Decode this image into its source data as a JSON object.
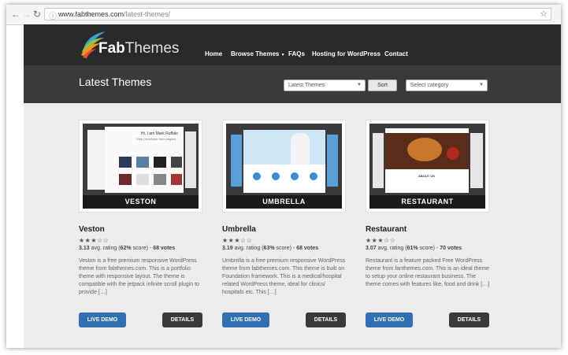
{
  "browser": {
    "back_icon": "back-arrow-icon",
    "forward_icon": "forward-arrow-icon",
    "reload_icon": "reload-icon",
    "url_host": "www.fabthemes.com",
    "url_path": "/latest-themes/",
    "bookmark_icon": "star-icon"
  },
  "header": {
    "logo_fab": "Fab",
    "logo_themes": "Themes",
    "nav": [
      {
        "label": "Home"
      },
      {
        "label": "Browse Themes"
      },
      {
        "label": "FAQs"
      },
      {
        "label": "Hosting for WordPress"
      },
      {
        "label": "Contact"
      }
    ],
    "page_title": "Latest Themes",
    "sort_select": "Latest Themes",
    "sort_button": "Sort",
    "category_select": "Select category"
  },
  "themes": [
    {
      "name": "Veston",
      "banner": "VESTON",
      "stars": "★★★☆☆",
      "score": "3.13",
      "rating_mid": " avg. rating (",
      "percent": "62%",
      "rating_tail": " score) - ",
      "votes": "68 votes",
      "description": "Veston is a free premium responsive WordPress theme from fabthemes.com. This is a portfolio theme with responsive layout. The theme is compatible with the jetpack infinite scroll plugin to provide […]",
      "screen_text_1": "Hi, I am Mark Ruffalo",
      "screen_text_2": "Web Developer from Asgard",
      "demo": "LIVE DEMO",
      "details": "DETAILS"
    },
    {
      "name": "Umbrella",
      "banner": "UMBRELLA",
      "stars": "★★★☆☆",
      "score": "3.19",
      "rating_mid": " avg. rating (",
      "percent": "63%",
      "rating_tail": " score) - ",
      "votes": "68 votes",
      "description": "Umbrella is a free premium responsive WordPress theme from fabthemes.com. This theme is built on Foundation framework. This is a medical/hospital related WordPress theme, ideal for clinics/ hospitals etc. This […]",
      "demo": "LIVE DEMO",
      "details": "DETAILS"
    },
    {
      "name": "Restaurant",
      "banner": "RESTAURANT",
      "stars": "★★★☆☆",
      "score": "3.07",
      "rating_mid": " avg. rating (",
      "percent": "61%",
      "rating_tail": " score) - ",
      "votes": "70 votes",
      "description": "Restaurant is a feature packed Free WordPress theme from fanthemes.com. This is an ideal theme to setup your online restaurant business. The theme comes with features like, food and drink […]",
      "screen_text_1": "ABOUT US",
      "demo": "LIVE DEMO",
      "details": "DETAILS"
    }
  ],
  "colors": {
    "header_top": "#2a2a2a",
    "header_sub": "#3a3a3a",
    "content_bg": "#ececec",
    "demo_button": "#2f6fb3",
    "details_button": "#3a3a3a"
  }
}
